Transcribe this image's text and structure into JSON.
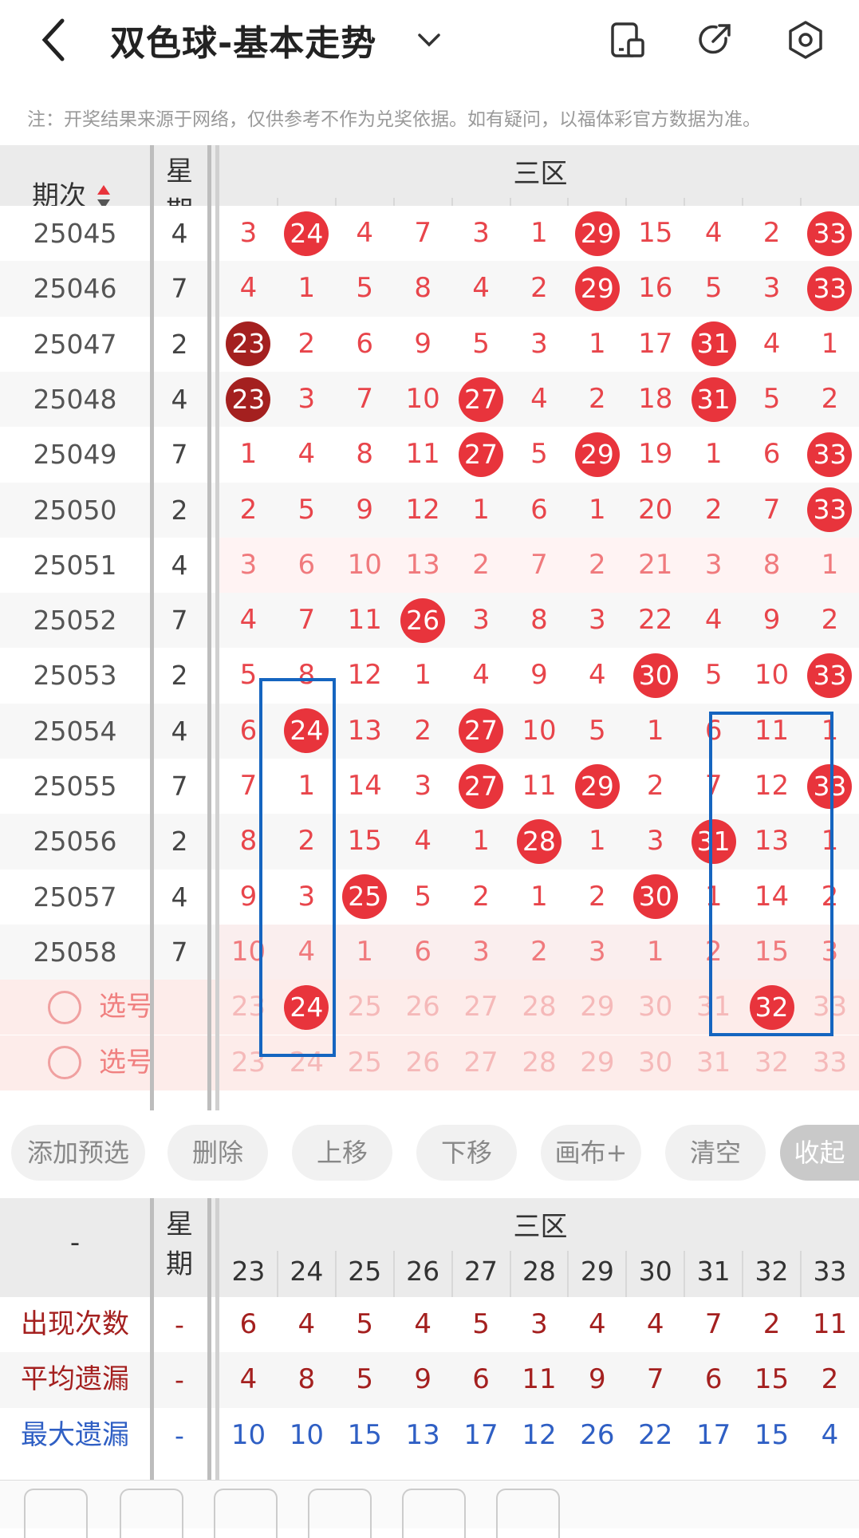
{
  "header": {
    "title": "双色球-基本走势",
    "icons": [
      "back-icon",
      "chevron-down-icon",
      "phone-layout-icon",
      "share-icon",
      "settings-icon"
    ]
  },
  "notice": "注：开奖结果来源于网络，仅供参考不作为兑奖依据。如有疑问，以福体彩官方数据为准。",
  "table": {
    "col_period": "期次",
    "col_week": "星期",
    "zone_label": "三区",
    "numbers": [
      "23",
      "24",
      "25",
      "26",
      "27",
      "28",
      "29",
      "30",
      "31",
      "32",
      "33"
    ],
    "rows": [
      {
        "period": "25045",
        "week": "4",
        "cells": [
          "3",
          "24",
          "4",
          "7",
          "3",
          "1",
          "29",
          "15",
          "4",
          "2",
          "33"
        ],
        "hits": [
          1,
          6,
          10
        ]
      },
      {
        "period": "25046",
        "week": "7",
        "cells": [
          "4",
          "1",
          "5",
          "8",
          "4",
          "2",
          "29",
          "16",
          "5",
          "3",
          "33"
        ],
        "hits": [
          6,
          10
        ]
      },
      {
        "period": "25047",
        "week": "2",
        "cells": [
          "23",
          "2",
          "6",
          "9",
          "5",
          "3",
          "1",
          "17",
          "31",
          "4",
          "1"
        ],
        "hits": [
          0,
          8
        ],
        "dark": [
          0
        ]
      },
      {
        "period": "25048",
        "week": "4",
        "cells": [
          "23",
          "3",
          "7",
          "10",
          "27",
          "4",
          "2",
          "18",
          "31",
          "5",
          "2"
        ],
        "hits": [
          0,
          4,
          8
        ],
        "dark": [
          0
        ]
      },
      {
        "period": "25049",
        "week": "7",
        "cells": [
          "1",
          "4",
          "8",
          "11",
          "27",
          "5",
          "29",
          "19",
          "1",
          "6",
          "33"
        ],
        "hits": [
          4,
          6,
          10
        ]
      },
      {
        "period": "25050",
        "week": "2",
        "cells": [
          "2",
          "5",
          "9",
          "12",
          "1",
          "6",
          "1",
          "20",
          "2",
          "7",
          "33"
        ],
        "hits": [
          10
        ]
      },
      {
        "period": "25051",
        "week": "4",
        "cells": [
          "3",
          "6",
          "10",
          "13",
          "2",
          "7",
          "2",
          "21",
          "3",
          "8",
          "1"
        ],
        "hits": []
      },
      {
        "period": "25052",
        "week": "7",
        "cells": [
          "4",
          "7",
          "11",
          "26",
          "3",
          "8",
          "3",
          "22",
          "4",
          "9",
          "2"
        ],
        "hits": [
          3
        ]
      },
      {
        "period": "25053",
        "week": "2",
        "cells": [
          "5",
          "8",
          "12",
          "1",
          "4",
          "9",
          "4",
          "30",
          "5",
          "10",
          "33"
        ],
        "hits": [
          7,
          10
        ]
      },
      {
        "period": "25054",
        "week": "4",
        "cells": [
          "6",
          "24",
          "13",
          "2",
          "27",
          "10",
          "5",
          "1",
          "6",
          "11",
          "1"
        ],
        "hits": [
          1,
          4
        ]
      },
      {
        "period": "25055",
        "week": "7",
        "cells": [
          "7",
          "1",
          "14",
          "3",
          "27",
          "11",
          "29",
          "2",
          "7",
          "12",
          "33"
        ],
        "hits": [
          4,
          6,
          10
        ]
      },
      {
        "period": "25056",
        "week": "2",
        "cells": [
          "8",
          "2",
          "15",
          "4",
          "1",
          "28",
          "1",
          "3",
          "31",
          "13",
          "1"
        ],
        "hits": [
          5,
          8
        ]
      },
      {
        "period": "25057",
        "week": "4",
        "cells": [
          "9",
          "3",
          "25",
          "5",
          "2",
          "1",
          "2",
          "30",
          "1",
          "14",
          "2"
        ],
        "hits": [
          2,
          7
        ]
      },
      {
        "period": "25058",
        "week": "7",
        "cells": [
          "10",
          "4",
          "1",
          "6",
          "3",
          "2",
          "3",
          "1",
          "2",
          "15",
          "3"
        ],
        "hits": []
      }
    ],
    "select_rows": [
      {
        "label": "选号",
        "selected": [
          1,
          9
        ]
      },
      {
        "label": "选号",
        "selected": []
      }
    ]
  },
  "buttons": [
    "添加预选",
    "删除",
    "上移",
    "下移",
    "画布+",
    "清空",
    "收起"
  ],
  "stats": {
    "corner": "-",
    "col_week": "星期",
    "zone_label": "三区",
    "numbers": [
      "23",
      "24",
      "25",
      "26",
      "27",
      "28",
      "29",
      "30",
      "31",
      "32",
      "33"
    ],
    "rows": [
      {
        "label": "出现次数",
        "week": "-",
        "values": [
          "6",
          "4",
          "5",
          "4",
          "5",
          "3",
          "4",
          "4",
          "7",
          "2",
          "11"
        ],
        "color": "#a4201f"
      },
      {
        "label": "平均遗漏",
        "week": "-",
        "values": [
          "4",
          "8",
          "5",
          "9",
          "6",
          "11",
          "9",
          "7",
          "6",
          "15",
          "2"
        ],
        "color": "#a4201f"
      },
      {
        "label": "最大遗漏",
        "week": "-",
        "values": [
          "10",
          "10",
          "15",
          "13",
          "17",
          "12",
          "26",
          "22",
          "17",
          "15",
          "4"
        ],
        "color": "#2f5fc4"
      }
    ]
  },
  "colors": {
    "accent": "#e8343c",
    "dark_ball": "#a4201f",
    "box": "#1565c0",
    "blue": "#2f5fc4"
  }
}
